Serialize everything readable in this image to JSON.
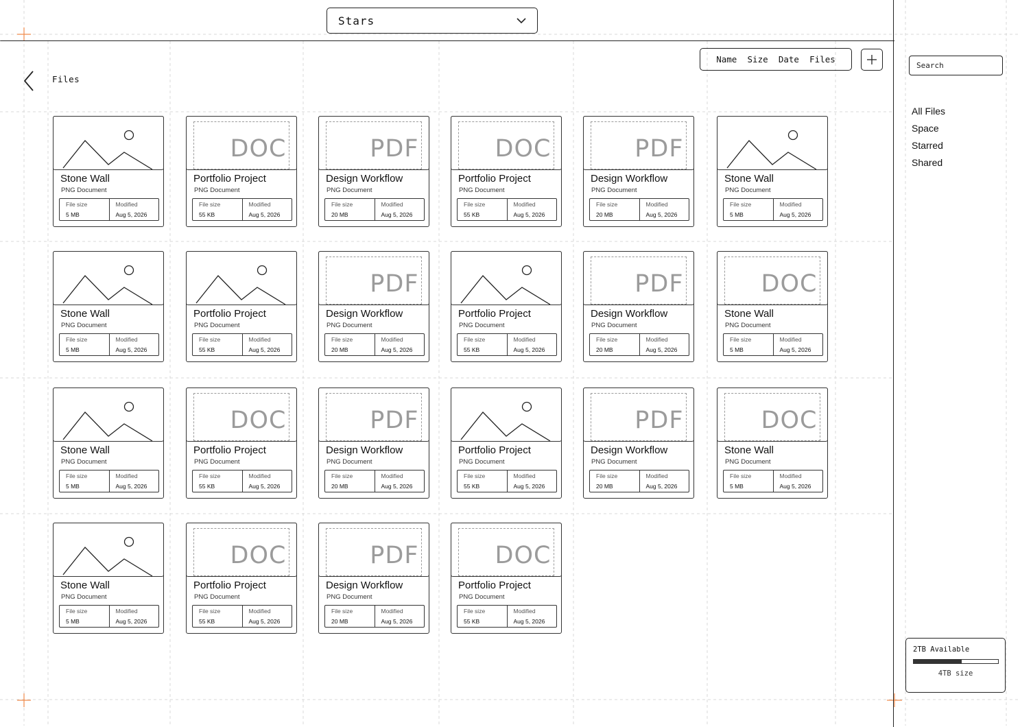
{
  "header": {
    "dropdown_value": "Stars",
    "sort_options": [
      "Name",
      "Size",
      "Date",
      "Files"
    ],
    "add_icon": "plus-icon"
  },
  "breadcrumb": {
    "back_icon": "chevron-left-icon",
    "label": "Files"
  },
  "files": [
    {
      "title": "Stone Wall",
      "subtitle": "PNG Document",
      "thumb": "image",
      "size_label": "File size",
      "size": "5 MB",
      "modified_label": "Modified",
      "modified": "Aug 5, 2026"
    },
    {
      "title": "Portfolio Project",
      "subtitle": "PNG Document",
      "thumb": "DOC",
      "size_label": "File size",
      "size": "55 KB",
      "modified_label": "Modified",
      "modified": "Aug 5, 2026"
    },
    {
      "title": "Design Workflow",
      "subtitle": "PNG Document",
      "thumb": "PDF",
      "size_label": "File size",
      "size": "20 MB",
      "modified_label": "Modified",
      "modified": "Aug 5, 2026"
    },
    {
      "title": "Portfolio Project",
      "subtitle": "PNG Document",
      "thumb": "DOC",
      "size_label": "File size",
      "size": "55 KB",
      "modified_label": "Modified",
      "modified": "Aug 5, 2026"
    },
    {
      "title": "Design Workflow",
      "subtitle": "PNG Document",
      "thumb": "PDF",
      "size_label": "File size",
      "size": "20 MB",
      "modified_label": "Modified",
      "modified": "Aug 5, 2026"
    },
    {
      "title": "Stone Wall",
      "subtitle": "PNG Document",
      "thumb": "image",
      "size_label": "File size",
      "size": "5 MB",
      "modified_label": "Modified",
      "modified": "Aug 5, 2026"
    },
    {
      "title": "Stone Wall",
      "subtitle": "PNG Document",
      "thumb": "image",
      "size_label": "File size",
      "size": "5 MB",
      "modified_label": "Modified",
      "modified": "Aug 5, 2026"
    },
    {
      "title": "Portfolio Project",
      "subtitle": "PNG Document",
      "thumb": "image",
      "size_label": "File size",
      "size": "55 KB",
      "modified_label": "Modified",
      "modified": "Aug 5, 2026"
    },
    {
      "title": "Design Workflow",
      "subtitle": "PNG Document",
      "thumb": "PDF",
      "size_label": "File size",
      "size": "20 MB",
      "modified_label": "Modified",
      "modified": "Aug 5, 2026"
    },
    {
      "title": "Portfolio Project",
      "subtitle": "PNG Document",
      "thumb": "image",
      "size_label": "File size",
      "size": "55 KB",
      "modified_label": "Modified",
      "modified": "Aug 5, 2026"
    },
    {
      "title": "Design Workflow",
      "subtitle": "PNG Document",
      "thumb": "PDF",
      "size_label": "File size",
      "size": "20 MB",
      "modified_label": "Modified",
      "modified": "Aug 5, 2026"
    },
    {
      "title": "Stone Wall",
      "subtitle": "PNG Document",
      "thumb": "DOC",
      "size_label": "File size",
      "size": "5 MB",
      "modified_label": "Modified",
      "modified": "Aug 5, 2026"
    },
    {
      "title": "Stone Wall",
      "subtitle": "PNG Document",
      "thumb": "image",
      "size_label": "File size",
      "size": "5 MB",
      "modified_label": "Modified",
      "modified": "Aug 5, 2026"
    },
    {
      "title": "Portfolio Project",
      "subtitle": "PNG Document",
      "thumb": "DOC",
      "size_label": "File size",
      "size": "55 KB",
      "modified_label": "Modified",
      "modified": "Aug 5, 2026"
    },
    {
      "title": "Design Workflow",
      "subtitle": "PNG Document",
      "thumb": "PDF",
      "size_label": "File size",
      "size": "20 MB",
      "modified_label": "Modified",
      "modified": "Aug 5, 2026"
    },
    {
      "title": "Portfolio Project",
      "subtitle": "PNG Document",
      "thumb": "image",
      "size_label": "File size",
      "size": "55 KB",
      "modified_label": "Modified",
      "modified": "Aug 5, 2026"
    },
    {
      "title": "Design Workflow",
      "subtitle": "PNG Document",
      "thumb": "PDF",
      "size_label": "File size",
      "size": "20 MB",
      "modified_label": "Modified",
      "modified": "Aug 5, 2026"
    },
    {
      "title": "Stone Wall",
      "subtitle": "PNG Document",
      "thumb": "DOC",
      "size_label": "File size",
      "size": "5 MB",
      "modified_label": "Modified",
      "modified": "Aug 5, 2026"
    },
    {
      "title": "Stone Wall",
      "subtitle": "PNG Document",
      "thumb": "image",
      "size_label": "File size",
      "size": "5 MB",
      "modified_label": "Modified",
      "modified": "Aug 5, 2026"
    },
    {
      "title": "Portfolio Project",
      "subtitle": "PNG Document",
      "thumb": "DOC",
      "size_label": "File size",
      "size": "55 KB",
      "modified_label": "Modified",
      "modified": "Aug 5, 2026"
    },
    {
      "title": "Design Workflow",
      "subtitle": "PNG Document",
      "thumb": "PDF",
      "size_label": "File size",
      "size": "20 MB",
      "modified_label": "Modified",
      "modified": "Aug 5, 2026"
    },
    {
      "title": "Portfolio Project",
      "subtitle": "PNG Document",
      "thumb": "DOC",
      "size_label": "File size",
      "size": "55 KB",
      "modified_label": "Modified",
      "modified": "Aug 5, 2026"
    }
  ],
  "sidebar": {
    "search_placeholder": "Search",
    "nav": [
      "All Files",
      "Space",
      "Starred",
      "Shared"
    ]
  },
  "storage": {
    "available": "2TB Available",
    "total": "4TB size",
    "used_fraction": 0.57
  },
  "colors": {
    "guide_accent": "#f08a4b",
    "stroke": "#222222",
    "placeholder_text": "#9b9b9b"
  }
}
